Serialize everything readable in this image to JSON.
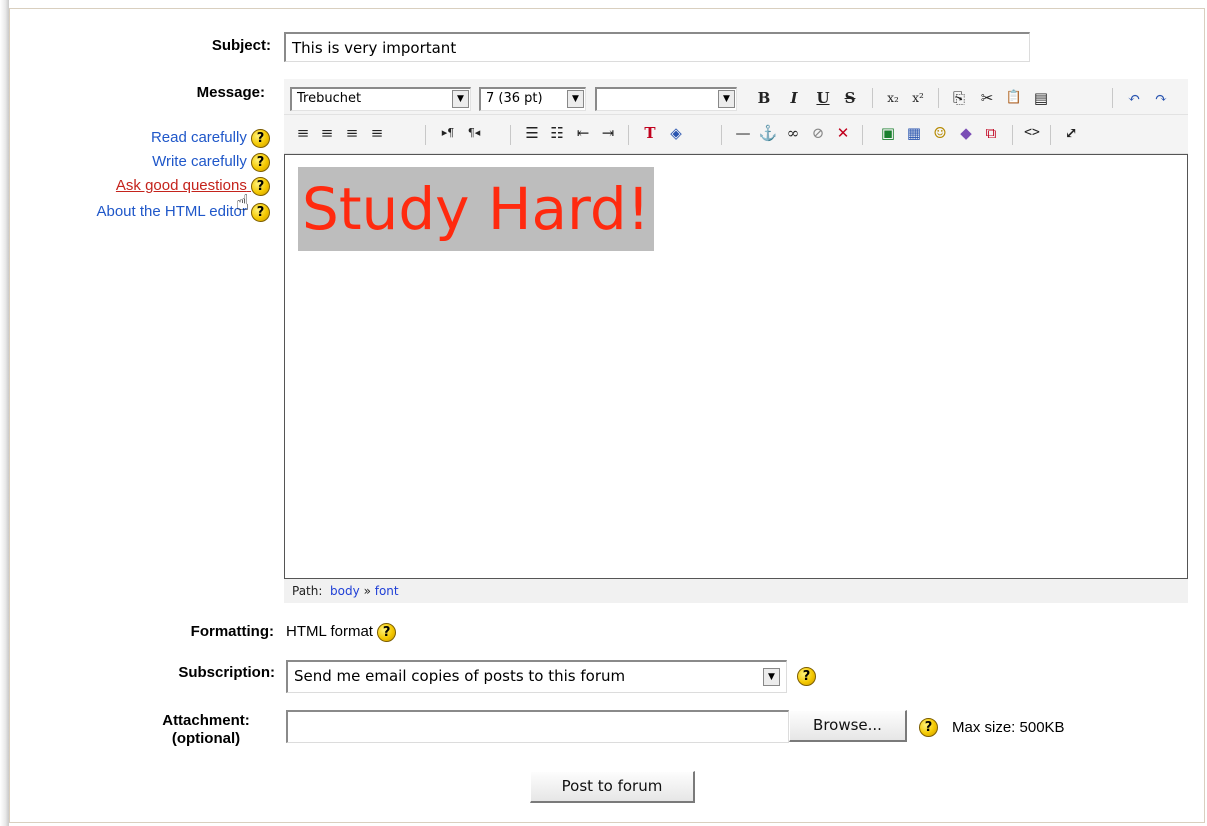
{
  "form": {
    "subject_label": "Subject:",
    "subject_value": "This is very important",
    "message_label": "Message:",
    "formatting_label": "Formatting:",
    "formatting_value": "HTML format",
    "subscription_label": "Subscription:",
    "subscription_value": "Send me email copies of posts to this forum",
    "attachment_label_line1": "Attachment:",
    "attachment_label_line2": "(optional)",
    "browse_label": "Browse...",
    "max_size": "Max size: 500KB",
    "submit_label": "Post to forum"
  },
  "help_links": [
    {
      "label": "Read carefully",
      "active": false
    },
    {
      "label": "Write carefully",
      "active": false
    },
    {
      "label": "Ask good questions",
      "active": true
    },
    {
      "label": "About the HTML editor",
      "active": false
    }
  ],
  "editor": {
    "font_name": "Trebuchet",
    "font_size": "7 (36 pt)",
    "heading": "",
    "content": "Study Hard!",
    "content_color": "#ff2a0f",
    "highlight_color": "#bdbdbd",
    "path_label": "Path:",
    "path_items": [
      "body",
      "font"
    ],
    "path_separator": "»"
  },
  "icons": {
    "help": "?",
    "dropdown": "▼",
    "bold": "B",
    "italic": "I",
    "underline": "U",
    "strike": "S",
    "subscript": "x₂",
    "superscript": "x²",
    "copy": "⎘",
    "cut": "✂",
    "paste": "📋",
    "paste_word": "▤",
    "undo": "↶",
    "redo": "↷",
    "align_left": "≡",
    "align_center": "≡",
    "align_right": "≡",
    "justify": "≡",
    "ltr": "▸¶",
    "rtl": "¶◂",
    "ordered_list": "☰",
    "unordered_list": "☷",
    "outdent": "⇤",
    "indent": "⇥",
    "text_color": "T",
    "bg_color": "◈",
    "hr": "—",
    "anchor": "⚓",
    "link": "∞",
    "unlink": "⊘",
    "nolink": "✕",
    "image": "▣",
    "table": "▦",
    "smiley": "☺",
    "special_char": "◆",
    "search_replace": "⧉",
    "html_source": "<>",
    "fullscreen": "⤢",
    "hand_cursor": "☝"
  }
}
